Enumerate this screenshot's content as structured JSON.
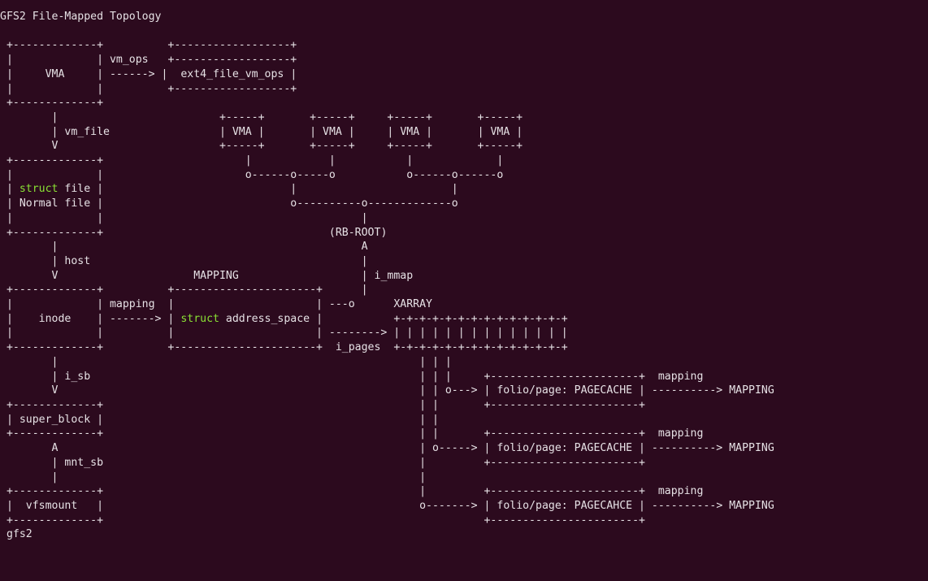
{
  "title": "GFS2 File-Mapped Topology",
  "footer": "gfs2",
  "boxes": {
    "vma": "VMA",
    "ext4_file_vm_ops": "ext4_file_vm_ops",
    "struct_file_line1_kw": "struct",
    "struct_file_line1_rest": " file",
    "struct_file_line2": "Normal file",
    "inode": "inode",
    "address_space_kw": "struct",
    "address_space_rest": " address_space",
    "super_block": "super_block",
    "vfsmount": "vfsmount",
    "folio1": "folio/page: PAGECACHE",
    "folio2": "folio/page: PAGECACHE",
    "folio3": "folio/page: PAGECAHCE"
  },
  "labels": {
    "vm_ops": "vm_ops",
    "vm_file": "vm_file",
    "host": "host",
    "mapping_header": "MAPPING",
    "mapping_edge": "mapping",
    "i_sb": "i_sb",
    "mnt_sb": "mnt_sb",
    "rb_root": "(RB-ROOT)",
    "i_mmap": "i_mmap",
    "xarray": "XARRAY",
    "i_pages": "i_pages",
    "mapping_out": "mapping",
    "mapping_target": "MAPPING"
  }
}
